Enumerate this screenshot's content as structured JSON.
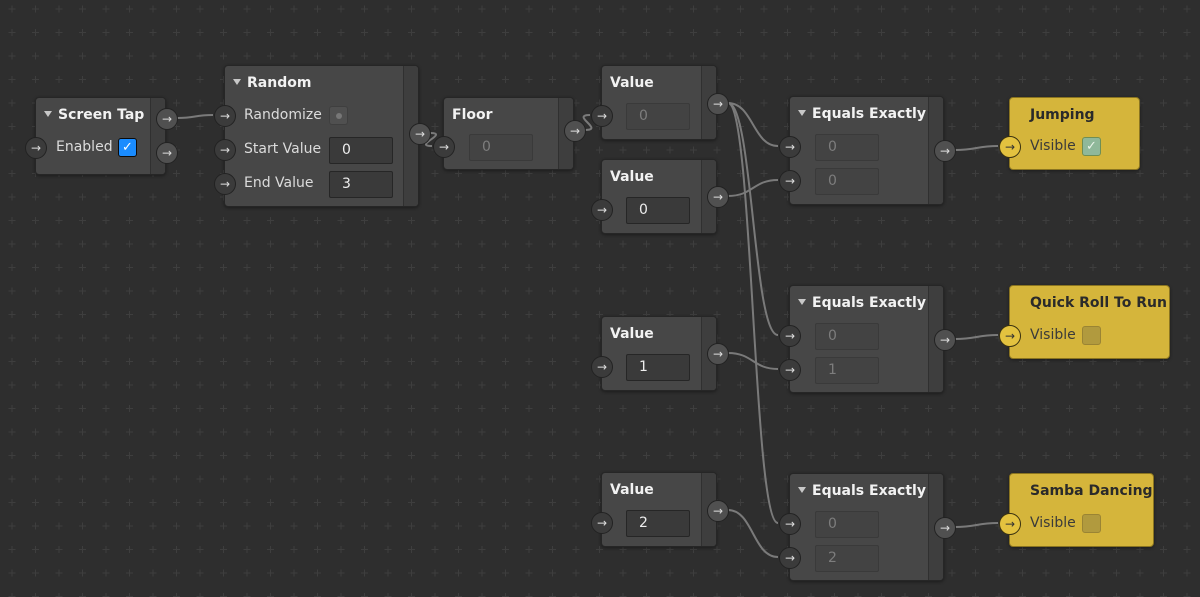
{
  "canvas": {
    "background": "#2e2e2e",
    "wire_color": "#7a7a7a",
    "patch_color": "#d5b53b"
  },
  "nodes": [
    {
      "id": "screen-tap",
      "title": "Screen Tap",
      "collapsible": true,
      "rows": [
        {
          "label": "Enabled",
          "checkbox": "checked"
        }
      ],
      "outputs": 2
    },
    {
      "id": "random",
      "title": "Random",
      "collapsible": true,
      "rows": [
        {
          "label": "Randomize",
          "checkbox": "dot"
        },
        {
          "label": "Start Value",
          "value": "0"
        },
        {
          "label": "End Value",
          "value": "3"
        }
      ],
      "outputs": 1
    },
    {
      "id": "floor",
      "title": "Floor",
      "collapsible": false,
      "rows": [
        {
          "label": "",
          "value": "0",
          "disabled": true
        }
      ],
      "outputs": 1
    },
    {
      "id": "value-1",
      "title": "Value",
      "collapsible": false,
      "rows": [
        {
          "label": "",
          "value": "0",
          "disabled": true
        }
      ],
      "outputs": 1
    },
    {
      "id": "value-2",
      "title": "Value",
      "collapsible": false,
      "rows": [
        {
          "label": "",
          "value": "0"
        }
      ],
      "outputs": 1
    },
    {
      "id": "value-3",
      "title": "Value",
      "collapsible": false,
      "rows": [
        {
          "label": "",
          "value": "1"
        }
      ],
      "outputs": 1
    },
    {
      "id": "value-4",
      "title": "Value",
      "collapsible": false,
      "rows": [
        {
          "label": "",
          "value": "2"
        }
      ],
      "outputs": 1
    },
    {
      "id": "equals-1",
      "title": "Equals Exactly",
      "collapsible": true,
      "rows": [
        {
          "label": "",
          "value": "0",
          "disabled": true
        },
        {
          "label": "",
          "value": "0",
          "disabled": true
        }
      ],
      "outputs": 1
    },
    {
      "id": "equals-2",
      "title": "Equals Exactly",
      "collapsible": true,
      "rows": [
        {
          "label": "",
          "value": "0",
          "disabled": true
        },
        {
          "label": "",
          "value": "1",
          "disabled": true
        }
      ],
      "outputs": 1
    },
    {
      "id": "equals-3",
      "title": "Equals Exactly",
      "collapsible": true,
      "rows": [
        {
          "label": "",
          "value": "0",
          "disabled": true
        },
        {
          "label": "",
          "value": "2",
          "disabled": true
        }
      ],
      "outputs": 1
    },
    {
      "id": "jumping",
      "title": "Jumping",
      "yellow": true,
      "rows": [
        {
          "label": "Visible",
          "checkbox": "checked-teal"
        }
      ],
      "outputs": 0
    },
    {
      "id": "quick-roll",
      "title": "Quick Roll To Run",
      "yellow": true,
      "rows": [
        {
          "label": "Visible",
          "checkbox": "off"
        }
      ],
      "outputs": 0
    },
    {
      "id": "samba",
      "title": "Samba Dancing",
      "yellow": true,
      "rows": [
        {
          "label": "Visible",
          "checkbox": "off"
        }
      ],
      "outputs": 0
    }
  ],
  "connections": [
    [
      "screen-tap",
      0,
      "random",
      0
    ],
    [
      "random",
      0,
      "floor",
      0
    ],
    [
      "floor",
      0,
      "value-1",
      0
    ],
    [
      "value-1",
      0,
      "equals-1",
      0
    ],
    [
      "value-1",
      0,
      "equals-2",
      0
    ],
    [
      "value-1",
      0,
      "equals-3",
      0
    ],
    [
      "value-2",
      0,
      "equals-1",
      1
    ],
    [
      "value-3",
      0,
      "equals-2",
      1
    ],
    [
      "value-4",
      0,
      "equals-3",
      1
    ],
    [
      "equals-1",
      0,
      "jumping",
      0
    ],
    [
      "equals-2",
      0,
      "quick-roll",
      0
    ],
    [
      "equals-3",
      0,
      "samba",
      0
    ]
  ]
}
